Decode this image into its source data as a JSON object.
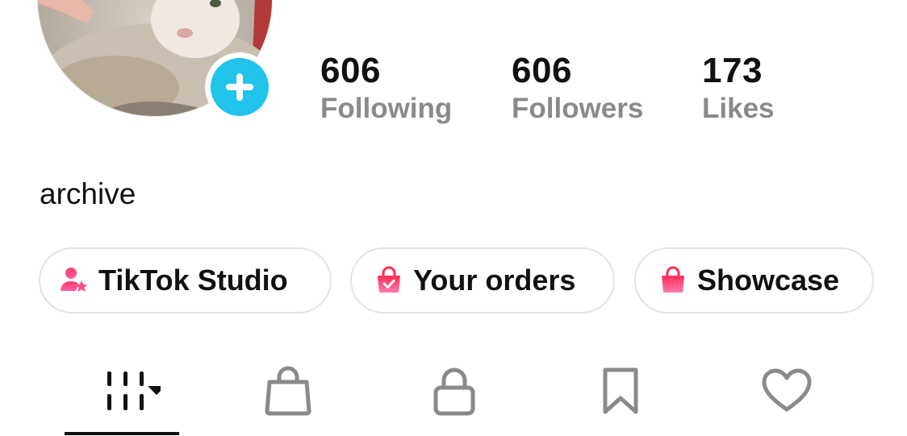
{
  "profile": {
    "avatar_alt": "cat photo",
    "add_icon": "plus-icon"
  },
  "stats": {
    "following": {
      "value": "606",
      "label": "Following"
    },
    "followers": {
      "value": "606",
      "label": "Followers"
    },
    "likes": {
      "value": "173",
      "label": "Likes"
    }
  },
  "bio": "archive",
  "actions": [
    {
      "label": "TikTok Studio",
      "icon": "studio-person-star-icon"
    },
    {
      "label": "Your orders",
      "icon": "shopping-bag-check-icon"
    },
    {
      "label": "Showcase",
      "icon": "shopping-bag-icon"
    }
  ],
  "tabs": [
    {
      "icon": "videos-grid-icon",
      "active": true
    },
    {
      "icon": "shop-bag-icon",
      "active": false
    },
    {
      "icon": "lock-icon",
      "active": false
    },
    {
      "icon": "bookmark-icon",
      "active": false
    },
    {
      "icon": "heart-icon",
      "active": false
    }
  ],
  "colors": {
    "accent_add": "#20c4eb",
    "pink_icon": "#fe2c55",
    "text_primary": "#111111",
    "text_secondary": "#8a8a8a",
    "tab_icon_inactive": "#8a8a8a"
  }
}
